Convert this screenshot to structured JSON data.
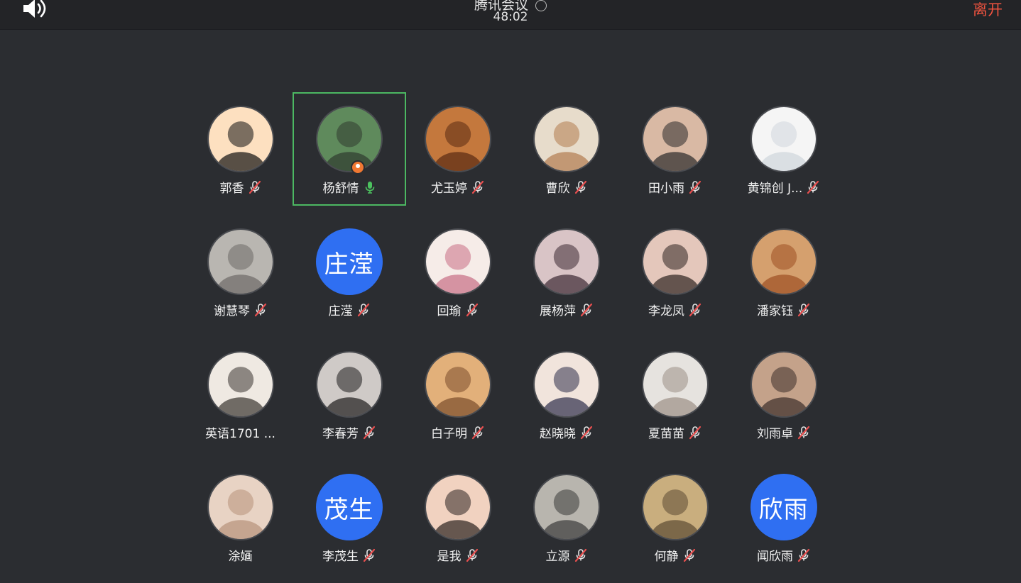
{
  "header": {
    "title": "腾讯会议",
    "timer": "48:02",
    "leave_label": "离开"
  },
  "participants": [
    {
      "name": "郭香",
      "avatar": "cartoon-glasses-girl",
      "mic": "muted",
      "palette": [
        "#fde0c0",
        "#111111"
      ]
    },
    {
      "name": "杨舒情",
      "avatar": "photo-station-sign",
      "mic": "on",
      "active": true,
      "host": true,
      "palette": [
        "#5f8a5c",
        "#2f3a2f"
      ]
    },
    {
      "name": "尤玉婷",
      "avatar": "illustration-monkey-king",
      "mic": "muted",
      "palette": [
        "#c4783d",
        "#5a2a12"
      ]
    },
    {
      "name": "曹欣",
      "avatar": "photo-white-cat",
      "mic": "muted",
      "palette": [
        "#e7dccb",
        "#b27b4f"
      ]
    },
    {
      "name": "田小雨",
      "avatar": "photo-laughing-man",
      "mic": "muted",
      "palette": [
        "#d9b9a4",
        "#2a2a2a"
      ]
    },
    {
      "name": "黄锦创 J...",
      "avatar": "sticker-cat-phone",
      "mic": "muted",
      "palette": [
        "#f5f5f5",
        "#cfd6dc"
      ]
    },
    {
      "name": "谢慧琴",
      "avatar": "photo-grey-cat",
      "mic": "muted",
      "palette": [
        "#b9b6b1",
        "#6d6a66"
      ]
    },
    {
      "name": "庄滢",
      "avatar_text": "庄滢",
      "mic": "muted"
    },
    {
      "name": "回瑜",
      "avatar": "illustration-flower-logo",
      "mic": "muted",
      "palette": [
        "#f6ece8",
        "#c86e84"
      ]
    },
    {
      "name": "展杨萍",
      "avatar": "photo-mirror-selfie",
      "mic": "muted",
      "palette": [
        "#d9c4c6",
        "#3c2a33"
      ]
    },
    {
      "name": "李龙凤",
      "avatar": "photo-girl-selfie",
      "mic": "muted",
      "palette": [
        "#e4c7bb",
        "#2e2320"
      ]
    },
    {
      "name": "潘家钰",
      "avatar": "photo-red-panda",
      "mic": "muted",
      "palette": [
        "#d5a06e",
        "#9c4f22"
      ]
    },
    {
      "name": "英语1701 ...",
      "avatar": "photo-dog-sunglasses",
      "mic": "none",
      "palette": [
        "#efe9e2",
        "#3a3431"
      ]
    },
    {
      "name": "李春芳",
      "avatar": "photo-girl-profile",
      "mic": "muted",
      "palette": [
        "#cfcac7",
        "#1e1c1c"
      ]
    },
    {
      "name": "白子明",
      "avatar": "photo-girl-closeup",
      "mic": "muted",
      "palette": [
        "#e2b07a",
        "#7a4d2b"
      ]
    },
    {
      "name": "赵晓晓",
      "avatar": "illustration-snow-white",
      "mic": "muted",
      "palette": [
        "#f1e4dc",
        "#2d2d4a"
      ]
    },
    {
      "name": "夏苗苗",
      "avatar": "photo-blanket-girl",
      "mic": "muted",
      "palette": [
        "#e6e3df",
        "#9b8f85"
      ]
    },
    {
      "name": "刘雨卓",
      "avatar": "photo-smiling-girl",
      "mic": "muted",
      "palette": [
        "#c4a28a",
        "#3c2e2a"
      ]
    },
    {
      "name": "涂婳",
      "avatar": "photo-cream-cat",
      "mic": "none",
      "palette": [
        "#e8d3c4",
        "#b7917a"
      ]
    },
    {
      "name": "李茂生",
      "avatar_text": "茂生",
      "mic": "muted"
    },
    {
      "name": "是我",
      "avatar": "photo-baby",
      "mic": "muted",
      "palette": [
        "#f1d2c0",
        "#2b2220"
      ]
    },
    {
      "name": "立源",
      "avatar": "photo-street-man",
      "mic": "muted",
      "palette": [
        "#b8b5ae",
        "#3b3b3b"
      ]
    },
    {
      "name": "何静",
      "avatar": "photo-vintage-girl",
      "mic": "muted",
      "palette": [
        "#c9ae7e",
        "#5b4a33"
      ]
    },
    {
      "name": "闻欣雨",
      "avatar_text": "欣雨",
      "mic": "muted"
    }
  ]
}
